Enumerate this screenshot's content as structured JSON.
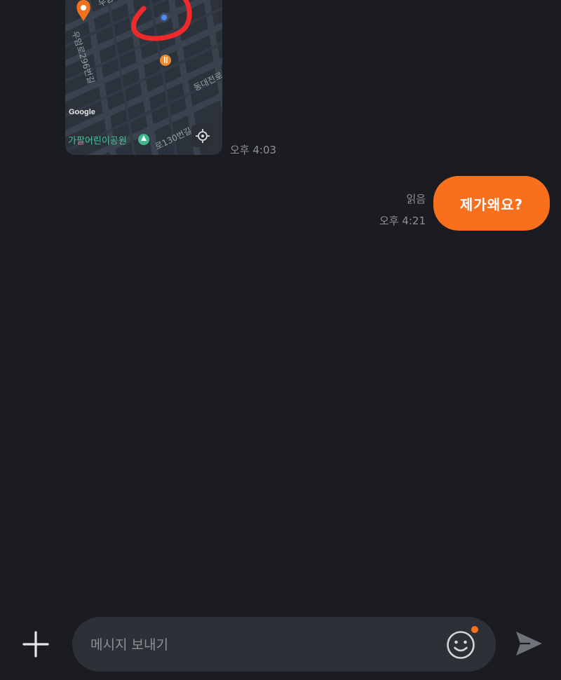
{
  "conversation": {
    "received": {
      "map": {
        "google_label": "Google",
        "park_label": "가팔어린이공원",
        "street_1": "우암로",
        "street_2": "우암로296번길",
        "street_3": "동대전로",
        "street_4": "로130번길"
      },
      "time": "오후 4:03"
    },
    "sent": {
      "text": "제가왜요?",
      "read_status": "읽음",
      "time": "오후 4:21"
    }
  },
  "composer": {
    "placeholder": "메시지 보내기",
    "value": ""
  },
  "icons": {
    "attach": "plus-icon",
    "emoji": "smiley-icon",
    "send": "send-arrow-icon",
    "map_pin": "map-pin-icon",
    "restaurant": "restaurant-icon",
    "park": "park-icon",
    "locate": "crosshair-icon"
  },
  "colors": {
    "background": "#1b1c21",
    "accent": "#fa6f1c",
    "bubble_text": "#ffffff",
    "muted_text": "#8d9096",
    "input_bg": "#2e3037",
    "annotation_red": "#ee2a2a"
  }
}
